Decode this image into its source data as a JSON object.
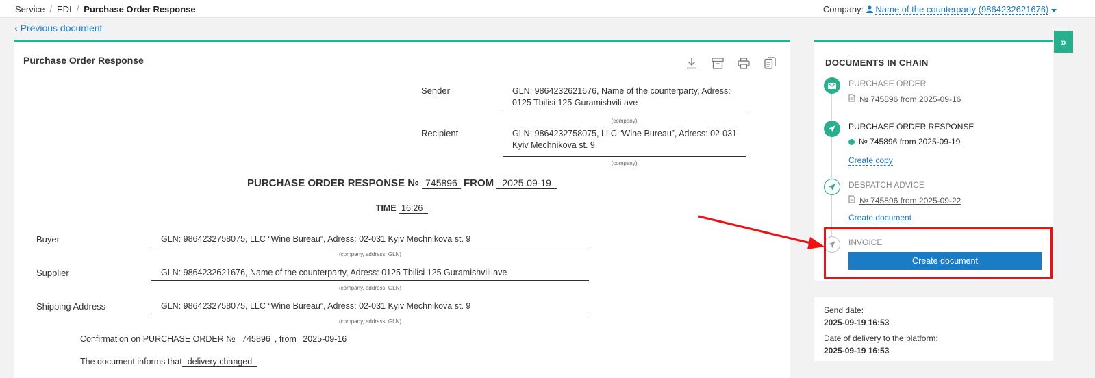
{
  "breadcrumb": {
    "items": [
      "Service",
      "EDI"
    ],
    "current": "Purchase Order Response"
  },
  "company": {
    "label": "Company:",
    "name": "Name of the counterparty (9864232621676)"
  },
  "nav": {
    "previous": "Previous document"
  },
  "document": {
    "heading": "Purchase Order Response",
    "sender_label": "Sender",
    "sender_value": "GLN: 9864232621676, Name of the counterparty, Adress: 0125 Tbilisi 125 Guramishvili ave",
    "sender_hint": "(company)",
    "recipient_label": "Recipient",
    "recipient_value": "GLN: 9864232758075, LLC “Wine Bureau”, Adress: 02-031 Kyiv Mechnikova st. 9",
    "recipient_hint": "(company)",
    "title_prefix": "PURCHASE ORDER RESPONSE №",
    "number": "745896",
    "from_label": "FROM",
    "date": "2025-09-19",
    "time_label": "TIME",
    "time": "16:26",
    "buyer_label": "Buyer",
    "buyer_value": "GLN: 9864232758075, LLC “Wine Bureau”, Adress: 02-031 Kyiv Mechnikova st. 9",
    "supplier_label": "Supplier",
    "supplier_value": "GLN: 9864232621676, Name of the counterparty, Adress: 0125 Tbilisi 125 Guramishvili ave",
    "shipping_label": "Shipping Address",
    "shipping_value": "GLN: 9864232758075, LLC “Wine Bureau”, Adress: 02-031 Kyiv Mechnikova st. 9",
    "party_hint": "(company, address, GLN)",
    "confirmation_prefix": "Confirmation on PURCHASE ORDER №",
    "confirmation_number": "745896",
    "confirmation_from": ", from",
    "confirmation_date": "2025-09-16",
    "informs_prefix": "The document informs that",
    "informs_value": "delivery changed"
  },
  "chain": {
    "title": "DOCUMENTS IN CHAIN",
    "steps": [
      {
        "name": "PURCHASE ORDER",
        "doc": "№ 745896 from 2025-09-16"
      },
      {
        "name": "PURCHASE ORDER RESPONSE",
        "doc": "№ 745896 from 2025-09-19",
        "link": "Create copy"
      },
      {
        "name": "DESPATCH ADVICE",
        "doc": "№ 745896 from 2025-09-22",
        "link": "Create document"
      },
      {
        "name": "INVOICE",
        "button": "Create document"
      }
    ]
  },
  "info": {
    "send_label": "Send date:",
    "send_value": "2025-09-19 16:53",
    "delivery_label": "Date of delivery to the platform:",
    "delivery_value": "2025-09-19 16:53"
  },
  "colors": {
    "accent": "#26b08e",
    "link": "#1a7cc4",
    "highlight": "#ee1111"
  }
}
